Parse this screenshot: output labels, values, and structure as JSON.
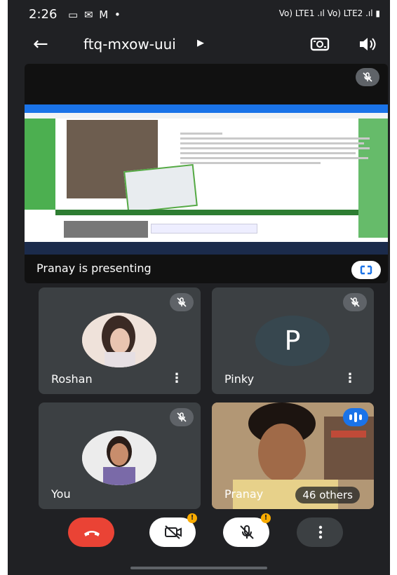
{
  "status": {
    "time": "2:26",
    "icons": "▭ ✉ M •",
    "right": "Vo) LTE1 .ıl Vo) LTE2 .ıl ▮"
  },
  "meeting": {
    "code": "ftq-mxow-uui"
  },
  "presentation": {
    "label": "Pranay is presenting"
  },
  "participants": [
    {
      "name": "Roshan",
      "muted": true,
      "kind": "photo"
    },
    {
      "name": "Pinky",
      "muted": true,
      "kind": "initial",
      "initial": "P"
    },
    {
      "name": "You",
      "muted": true,
      "kind": "photo"
    },
    {
      "name": "Pranay",
      "muted": false,
      "kind": "video",
      "others": "46 others"
    }
  ],
  "controls": [
    "end-call",
    "camera-off",
    "mic-off",
    "more"
  ],
  "colors": {
    "background": "#202124",
    "tile": "#3c4043",
    "end_call": "#ea4335",
    "speaking": "#1a73e8",
    "warning_dot": "#f9ab00"
  },
  "icons": {
    "back": "arrow-left-icon",
    "switch_camera": "camera-switch-icon",
    "speaker": "speaker-icon",
    "mic_off": "mic-off-icon",
    "fullscreen": "fullscreen-icon",
    "more": "more-vert-icon"
  }
}
